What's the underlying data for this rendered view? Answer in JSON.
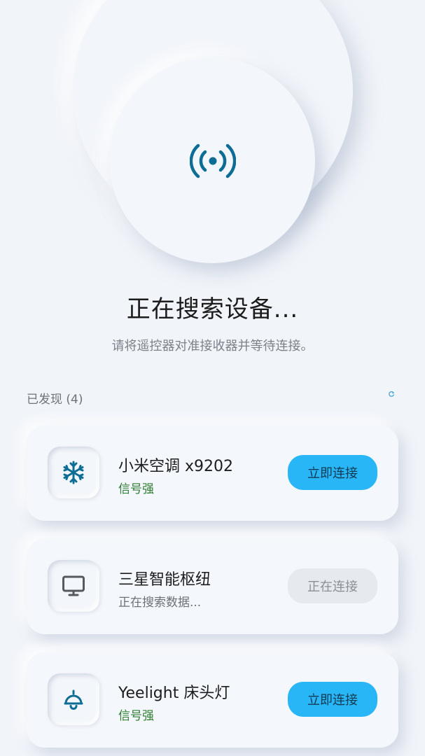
{
  "radar": {
    "icon": "signal-broadcast-icon",
    "accent": "#0e6d95"
  },
  "header": {
    "title": "正在搜索设备...",
    "subtitle": "请将遥控器对准接收器并等待连接。"
  },
  "section": {
    "label": "已发现 (4)",
    "refresh_icon": "refresh-icon"
  },
  "devices": [
    {
      "name": "小米空调 x9202",
      "status": "信号强",
      "action": "立即连接",
      "icon": "snowflake-icon"
    },
    {
      "name": "三星智能枢纽",
      "status": "正在搜索数据...",
      "action": "正在连接",
      "icon": "monitor-icon"
    },
    {
      "name": "Yeelight 床头灯",
      "status": "信号强",
      "action": "立即连接",
      "icon": "lamp-icon"
    }
  ],
  "colors": {
    "primary_button": "#29b6f6",
    "status_strong": "#2e7d32",
    "icon_teal": "#0e6d95",
    "background": "#f1f4f9"
  }
}
